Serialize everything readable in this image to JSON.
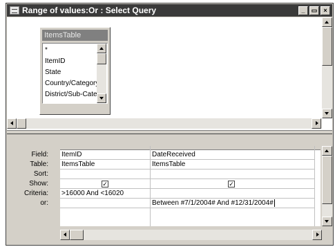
{
  "window": {
    "title": "Range of values:Or : Select Query",
    "minimize_glyph": "_",
    "maximize_glyph": "▭",
    "close_glyph": "×"
  },
  "table_box": {
    "name": "ItemsTable",
    "fields": [
      "*",
      "ItemID",
      "State",
      "Country/Category",
      "District/Sub-Category"
    ]
  },
  "grid": {
    "row_labels": {
      "field": "Field:",
      "table": "Table:",
      "sort": "Sort:",
      "show": "Show:",
      "criteria": "Criteria:",
      "or": "or:"
    },
    "columns": [
      {
        "field": "ItemID",
        "table": "ItemsTable",
        "sort": "",
        "show": true,
        "criteria": ">16000 And <16020",
        "or": ""
      },
      {
        "field": "DateReceived",
        "table": "ItemsTable",
        "sort": "",
        "show": true,
        "criteria": "",
        "or": "Between #7/1/2004# And #12/31/2004#"
      }
    ]
  },
  "icons": {
    "app": "query-icon",
    "check": "✓"
  }
}
